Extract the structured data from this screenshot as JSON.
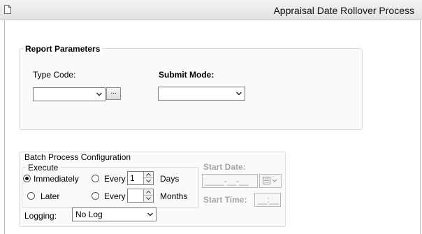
{
  "window": {
    "title": "Appraisal Date Rollover Process"
  },
  "report_parameters": {
    "legend": "Report Parameters",
    "type_code_label": "Type Code:",
    "type_code_value": "",
    "lookup_label": "...",
    "submit_mode_label": "Submit Mode:",
    "submit_mode_value": ""
  },
  "batch": {
    "legend": "Batch Process Configuration",
    "execute_legend": "Execute",
    "immediately_label": "Immediately",
    "later_label": "Later",
    "every_label_1": "Every",
    "every_label_2": "Every",
    "days_value": "1",
    "days_label": "Days",
    "months_value": "",
    "months_label": "Months",
    "start_date_label": "Start Date:",
    "start_date_value": "____-__-__",
    "start_time_label": "Start Time:",
    "start_time_value": "__:__",
    "logging_label": "Logging:",
    "logging_value": "No Log",
    "selected": "Immediately"
  },
  "icons": [
    "document-icon",
    "chevron-down-icon",
    "calendar-icon",
    "spin-up-icon",
    "spin-down-icon"
  ]
}
